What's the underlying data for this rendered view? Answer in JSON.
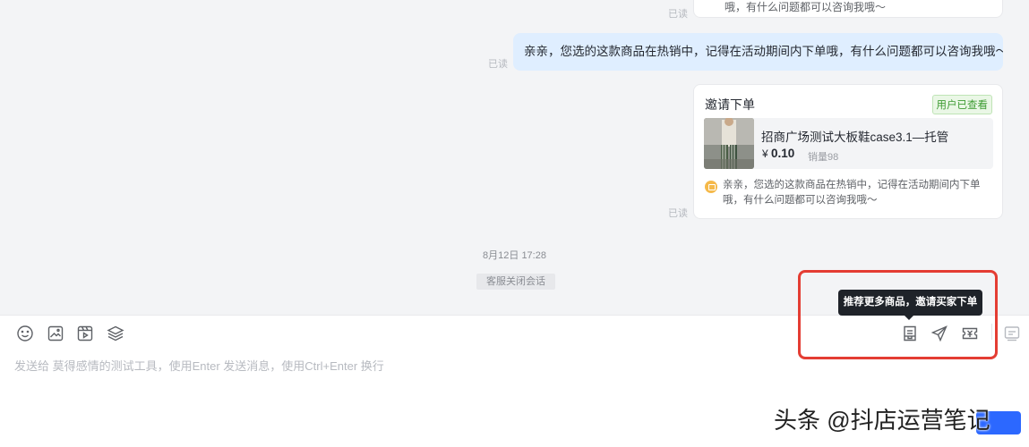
{
  "conversation": {
    "read_label": "已读",
    "top_card_note": "哦，有什么问题都可以咨询我哦～",
    "agent_message": "亲亲，您选的这款商品在热销中，记得在活动期间内下单哦，有什么问题都可以咨询我哦～",
    "invite_card": {
      "title": "邀请下单",
      "status": "用户已查看",
      "product_name": "招商广场测试大板鞋case3.1—托管",
      "price_symbol": "¥",
      "price": "0.10",
      "sales": "销量98",
      "note": "亲亲，您选的这款商品在热销中，记得在活动期间内下单哦，有什么问题都可以咨询我哦～",
      "status_color": "#3f9c34"
    },
    "timestamp": "8月12日 17:28",
    "system_note": "客服关闭会话"
  },
  "composer": {
    "placeholder": "发送给 莫得感情的测试工具，使用Enter 发送消息，使用Ctrl+Enter 换行",
    "left_tools": [
      "smile-icon",
      "image-icon",
      "video-icon",
      "layers-icon"
    ],
    "right_tools": [
      "recommend-product-icon",
      "send-plane-icon",
      "coupon-icon",
      "quick-reply-icon"
    ],
    "tooltip": "推荐更多商品，邀请买家下单",
    "accent_color": "#2c68ff",
    "highlight_color": "#e43d33"
  },
  "watermark": "头条 @抖店运营笔记"
}
